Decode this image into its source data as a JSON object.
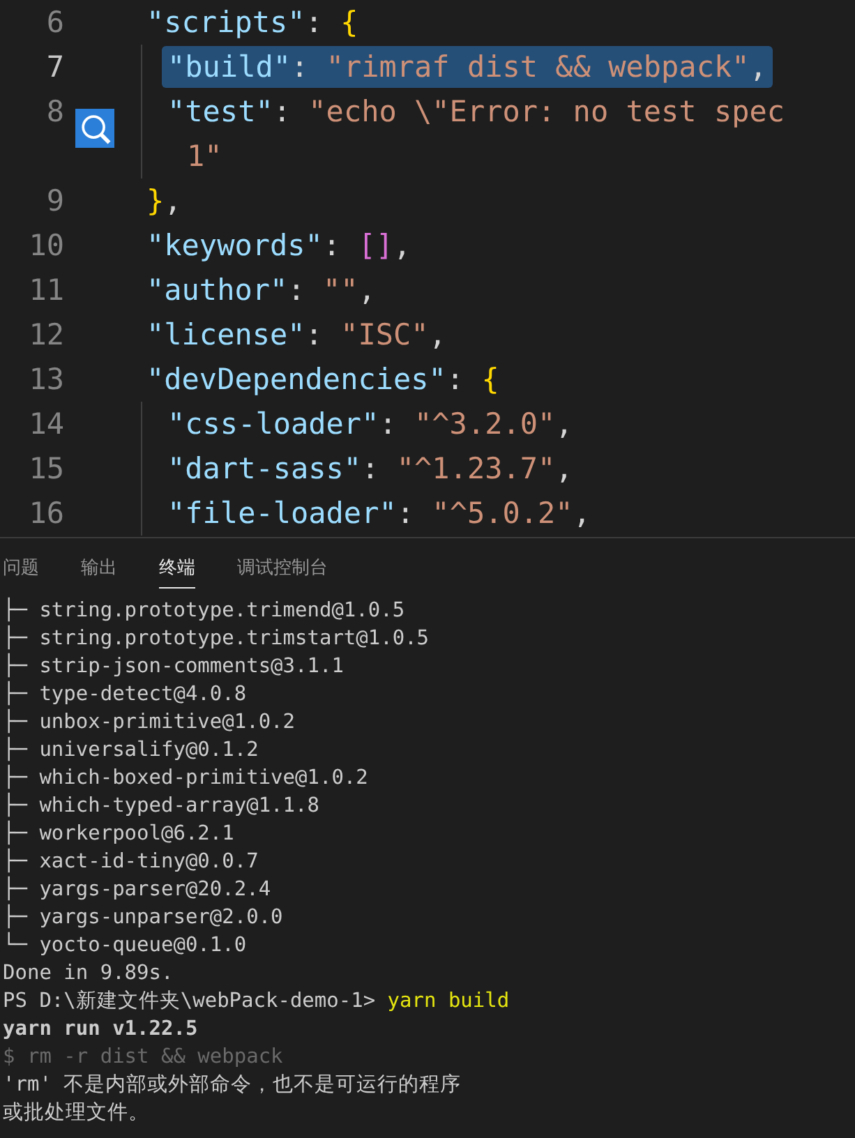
{
  "editor": {
    "lines": [
      {
        "number": "6",
        "selected": false,
        "tokens": [
          {
            "kind": "key",
            "text": "\"scripts\""
          },
          {
            "kind": "punct",
            "text": ": "
          },
          {
            "kind": "brace",
            "text": "{"
          }
        ],
        "children": [
          {
            "number": "7",
            "selected": true,
            "tokens": [
              {
                "kind": "key",
                "text": "\"build\""
              },
              {
                "kind": "punct",
                "text": ": "
              },
              {
                "kind": "string",
                "text": "\"rimraf dist && webpack\""
              },
              {
                "kind": "punct",
                "text": ","
              }
            ]
          },
          {
            "number": "8",
            "selected": false,
            "tokens": [
              {
                "kind": "key",
                "text": "\"test\""
              },
              {
                "kind": "punct",
                "text": ": "
              },
              {
                "kind": "string",
                "text": "\"echo \\\"Error: no test spec"
              }
            ],
            "continuation": "1\""
          }
        ]
      },
      {
        "number": "9",
        "selected": false,
        "tokens": [
          {
            "kind": "brace",
            "text": "}"
          },
          {
            "kind": "punct",
            "text": ","
          }
        ]
      },
      {
        "number": "10",
        "selected": false,
        "tokens": [
          {
            "kind": "key",
            "text": "\"keywords\""
          },
          {
            "kind": "punct",
            "text": ": "
          },
          {
            "kind": "bracket",
            "text": "[]"
          },
          {
            "kind": "punct",
            "text": ","
          }
        ]
      },
      {
        "number": "11",
        "selected": false,
        "tokens": [
          {
            "kind": "key",
            "text": "\"author\""
          },
          {
            "kind": "punct",
            "text": ": "
          },
          {
            "kind": "string",
            "text": "\"\""
          },
          {
            "kind": "punct",
            "text": ","
          }
        ]
      },
      {
        "number": "12",
        "selected": false,
        "tokens": [
          {
            "kind": "key",
            "text": "\"license\""
          },
          {
            "kind": "punct",
            "text": ": "
          },
          {
            "kind": "string",
            "text": "\"ISC\""
          },
          {
            "kind": "punct",
            "text": ","
          }
        ]
      },
      {
        "number": "13",
        "selected": false,
        "tokens": [
          {
            "kind": "key",
            "text": "\"devDependencies\""
          },
          {
            "kind": "punct",
            "text": ": "
          },
          {
            "kind": "brace",
            "text": "{"
          }
        ],
        "children": [
          {
            "number": "14",
            "selected": false,
            "tokens": [
              {
                "kind": "key",
                "text": "\"css-loader\""
              },
              {
                "kind": "punct",
                "text": ": "
              },
              {
                "kind": "string",
                "text": "\"^3.2.0\""
              },
              {
                "kind": "punct",
                "text": ","
              }
            ]
          },
          {
            "number": "15",
            "selected": false,
            "tokens": [
              {
                "kind": "key",
                "text": "\"dart-sass\""
              },
              {
                "kind": "punct",
                "text": ": "
              },
              {
                "kind": "string",
                "text": "\"^1.23.7\""
              },
              {
                "kind": "punct",
                "text": ","
              }
            ]
          },
          {
            "number": "16",
            "selected": false,
            "tokens": [
              {
                "kind": "key",
                "text": "\"file-loader\""
              },
              {
                "kind": "punct",
                "text": ": "
              },
              {
                "kind": "string",
                "text": "\"^5.0.2\""
              },
              {
                "kind": "punct",
                "text": ","
              }
            ]
          }
        ]
      }
    ]
  },
  "panel": {
    "tabs": [
      {
        "label": "问题",
        "selected": false
      },
      {
        "label": "输出",
        "selected": false
      },
      {
        "label": "终端",
        "selected": true
      },
      {
        "label": "调试控制台",
        "selected": false
      }
    ],
    "terminal": [
      {
        "kind": "normal",
        "text": "├─ string.prototype.trimend@1.0.5"
      },
      {
        "kind": "normal",
        "text": "├─ string.prototype.trimstart@1.0.5"
      },
      {
        "kind": "normal",
        "text": "├─ strip-json-comments@3.1.1"
      },
      {
        "kind": "normal",
        "text": "├─ type-detect@4.0.8"
      },
      {
        "kind": "normal",
        "text": "├─ unbox-primitive@1.0.2"
      },
      {
        "kind": "normal",
        "text": "├─ universalify@0.1.2"
      },
      {
        "kind": "normal",
        "text": "├─ which-boxed-primitive@1.0.2"
      },
      {
        "kind": "normal",
        "text": "├─ which-typed-array@1.1.8"
      },
      {
        "kind": "normal",
        "text": "├─ workerpool@6.2.1"
      },
      {
        "kind": "normal",
        "text": "├─ xact-id-tiny@0.0.7"
      },
      {
        "kind": "normal",
        "text": "├─ yargs-parser@20.2.4"
      },
      {
        "kind": "normal",
        "text": "├─ yargs-unparser@2.0.0"
      },
      {
        "kind": "normal",
        "text": "└─ yocto-queue@0.1.0"
      },
      {
        "kind": "normal",
        "text": "Done in 9.89s."
      },
      {
        "kind": "prompt",
        "text": "PS D:\\新建文件夹\\webPack-demo-1>",
        "command": "yarn build"
      },
      {
        "kind": "bold",
        "text": "yarn run v1.22.5"
      },
      {
        "kind": "dim",
        "text": "$ rm -r dist && webpack"
      },
      {
        "kind": "normal",
        "text": "'rm' 不是内部或外部命令，也不是可运行的程序"
      },
      {
        "kind": "normal",
        "text": "或批处理文件。"
      }
    ]
  }
}
